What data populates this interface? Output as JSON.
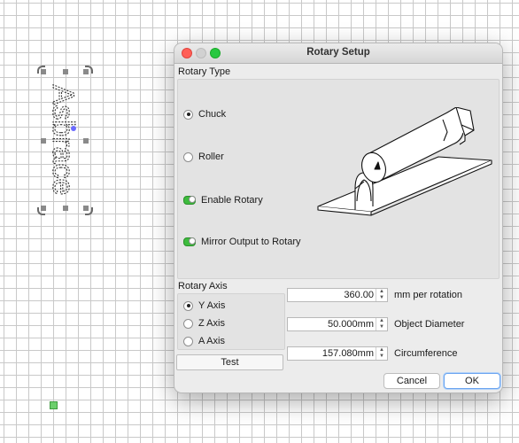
{
  "dialog": {
    "title": "Rotary Setup",
    "rotary_type": {
      "label": "Rotary Type",
      "options": [
        {
          "label": "Chuck",
          "selected": true
        },
        {
          "label": "Roller",
          "selected": false
        }
      ],
      "toggles": [
        {
          "label": "Enable Rotary",
          "on": true
        },
        {
          "label": "Mirror Output to Rotary",
          "on": true
        }
      ]
    },
    "rotary_axis": {
      "label": "Rotary Axis",
      "options": [
        {
          "label": "Y Axis",
          "selected": true
        },
        {
          "label": "Z Axis",
          "selected": false
        },
        {
          "label": "A Axis",
          "selected": false
        }
      ],
      "test_label": "Test"
    },
    "fields": [
      {
        "value": "360.00",
        "label": "mm per rotation"
      },
      {
        "value": "50.000mm",
        "label": "Object Diameter"
      },
      {
        "value": "157.080mm",
        "label": "Circumference"
      }
    ],
    "cancel_label": "Cancel",
    "ok_label": "OK"
  },
  "canvas": {
    "text_object": "Asbrace",
    "colors": {
      "selection_handle": "#8a8a8a",
      "origin_marker": "#6ccf6c",
      "rotate_dot": "#6b6bff"
    }
  }
}
